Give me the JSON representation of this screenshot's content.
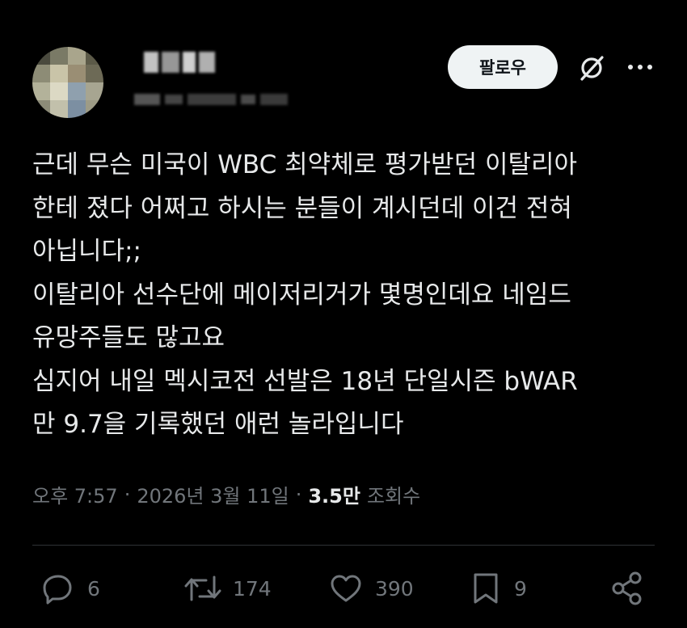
{
  "header": {
    "follow_label": "팔로우",
    "icons": [
      "grok-icon",
      "more-icon"
    ]
  },
  "tweet": {
    "lines": [
      "근데 무슨 미국이 WBC 최약체로 평가받던 이탈리아",
      "한테 졌다 어쩌고 하시는 분들이 계시던데 이건 전혀",
      "아닙니다;;",
      "이탈리아 선수단에 메이저리거가 몇명인데요 네임드",
      "유망주들도 많고요",
      "심지어 내일 멕시코전 선발은 18년 단일시즌 bWAR",
      "만 9.7을 기록했던 애런 놀라입니다"
    ]
  },
  "meta": {
    "time": "오후 7:57",
    "separator": "·",
    "date": "2026년 3월 11일",
    "views_count": "3.5만",
    "views_label": "조회수"
  },
  "actions": {
    "replies": "6",
    "reposts": "174",
    "likes": "390",
    "bookmarks": "9"
  },
  "colors": {
    "background": "#000000",
    "text": "#e7e9ea",
    "secondary": "#71767b",
    "divider": "#2f3336",
    "follow_bg": "#eff3f4"
  }
}
